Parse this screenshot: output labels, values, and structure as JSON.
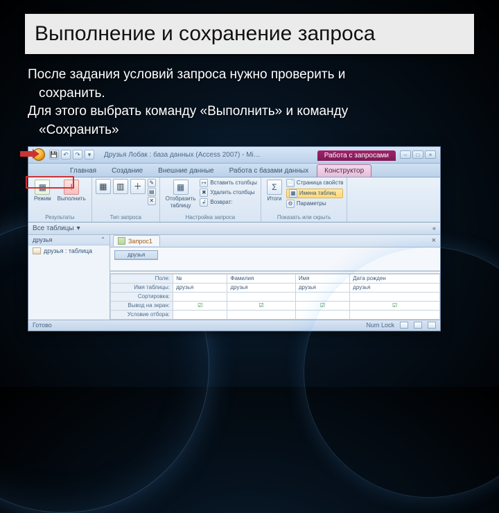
{
  "slide": {
    "title": "Выполнение и сохранение запроса",
    "p1": "После задания условий запроса нужно проверить и",
    "p1_indent": "сохранить.",
    "p2": "Для этого выбрать команду «Выполнить» и команду",
    "p2_indent": "«Сохранить»"
  },
  "window": {
    "caption": "Друзья Лобак : база данных (Access 2007) - Mi…",
    "context_tab": "Работа с запросами",
    "tabs": [
      "Главная",
      "Создание",
      "Внешние данные",
      "Работа с базами данных",
      "Конструктор"
    ],
    "active_tab_index": 4
  },
  "ribbon": {
    "results_group": "Результаты",
    "btn_mode": "Режим",
    "btn_run": "Выполнить",
    "querytype_group": "Тип запроса",
    "show_table": "Отобразить",
    "show_table2": "таблицу",
    "setup_group": "Настройка запроса",
    "insert_cols": "Вставить столбцы",
    "delete_cols": "Удалить столбцы",
    "return_lbl": "Возврат:",
    "sigma": "Итоги",
    "showhide_group": "Показать или скрыть",
    "page_props": "Страница свойств",
    "table_names": "Имена таблиц",
    "params": "Параметры"
  },
  "nav": {
    "header": "Все таблицы",
    "collapse": "«",
    "group": "друзья",
    "item": "друзья : таблица"
  },
  "doc": {
    "tab": "Запрос1",
    "table_in_designer": "друзья"
  },
  "grid": {
    "rows": [
      "Поле:",
      "Имя таблицы:",
      "Сортировка:",
      "Вывод на экран:",
      "Условие отбора:"
    ],
    "col1": {
      "field": "№",
      "table": "друзья"
    },
    "col2": {
      "field": "Фамилия",
      "table": "друзья"
    },
    "col3": {
      "field": "Имя",
      "table": "друзья"
    },
    "col4": {
      "field": "Дата рожден",
      "table": "друзья"
    }
  },
  "status": {
    "left": "Готово",
    "lock": "Num Lock"
  }
}
